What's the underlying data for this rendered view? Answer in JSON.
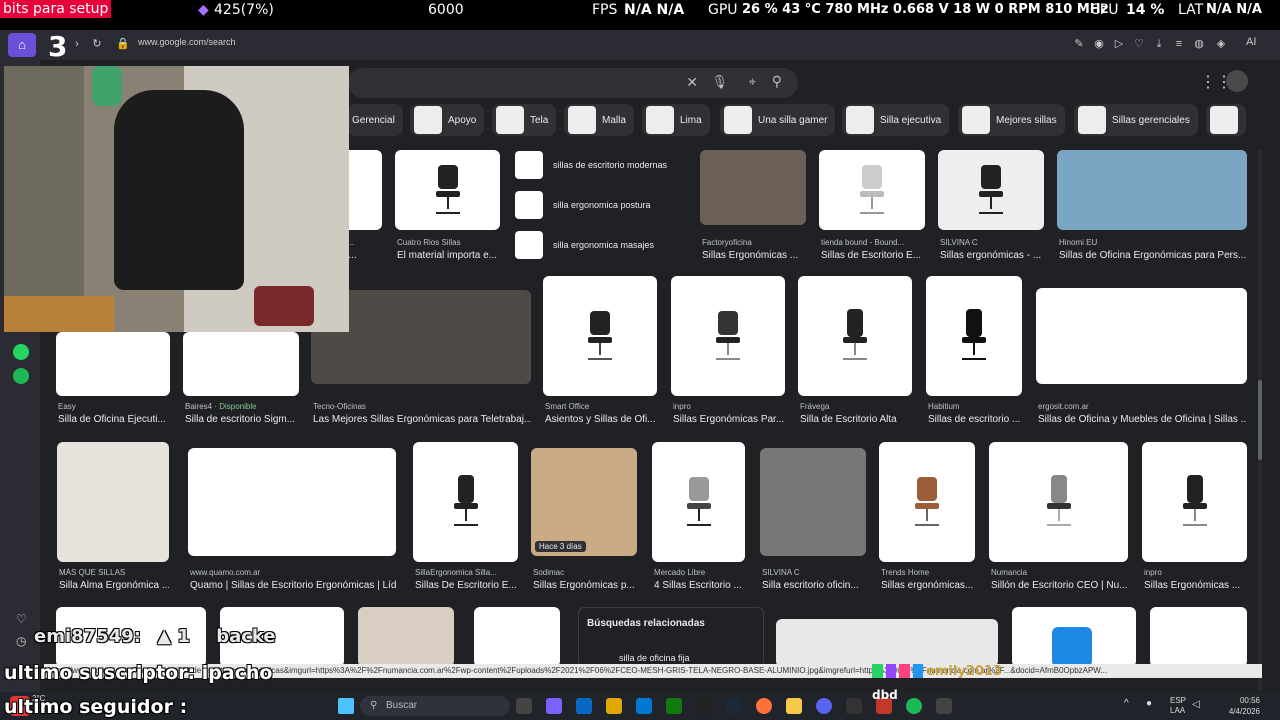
{
  "overlay": {
    "bits_label": "bits para setup",
    "bits_value": "425(7%)",
    "goal": "6000",
    "fps_label": "FPS",
    "fps_value": "N/A N/A",
    "gpu_label": "GPU",
    "gpu_stats": "26 % 43 °C 780 MHz 0.668 V 18 W 0 RPM 810 MHz",
    "cpu_label": "CPU",
    "cpu_value": "14 %",
    "lat_label": "LAT",
    "lat_value": "N/A N/A",
    "subscriber_label": "ultimo suscriptor: ipacho",
    "follower_label": "ultimo seguidor :",
    "chat_user": "emi87549:",
    "chat_msg": "backe",
    "chat_number": "1",
    "chat_user2": "emily2013",
    "alert_text": "dbd"
  },
  "browser": {
    "url": "www.google.com/search",
    "tab_counter": "3",
    "ai_label": "AI"
  },
  "chips": [
    {
      "label": "Gerencial"
    },
    {
      "label": "Apoyo"
    },
    {
      "label": "Tela"
    },
    {
      "label": "Malla"
    },
    {
      "label": "Lima"
    },
    {
      "label": "Una silla gamer"
    },
    {
      "label": "Silla ejecutiva"
    },
    {
      "label": "Mejores sillas"
    },
    {
      "label": "Sillas gerenciales"
    }
  ],
  "related_top": [
    {
      "text": "sillas de escritorio modernas"
    },
    {
      "text": "silla ergonomica postura"
    },
    {
      "text": "silla ergonomica masajes"
    }
  ],
  "row1": [
    {
      "source": "s de ...",
      "title": "ctric..."
    },
    {
      "source": "Cuatro Rios Sillas",
      "title": "El material importa e..."
    },
    {
      "source": "Factoryoficina",
      "title": "Sillas Ergonómicas ..."
    },
    {
      "source": "tienda bound - Bound...",
      "title": "Sillas de Escritorio E..."
    },
    {
      "source": "SILVINA C",
      "title": "Sillas ergonómicas - ..."
    },
    {
      "source": "Hinomi EU",
      "title": "Sillas de Oficina Ergonómicas para Pers..."
    }
  ],
  "row2": [
    {
      "source": "Easy",
      "title": "Silla de Oficina Ejecuti..."
    },
    {
      "source": "Baires4",
      "badge": "Disponible",
      "title": "Silla de escritorio Sigm..."
    },
    {
      "source": "Tecno-Oficinas",
      "title": "Las Mejores Sillas Ergonómicas para Teletrabaj..."
    },
    {
      "source": "Smart Office",
      "title": "Asientos y Sillas de Ofi..."
    },
    {
      "source": "inpro",
      "title": "Sillas Ergonómicas Par..."
    },
    {
      "source": "Frávega",
      "title": "Silla de Escritorio Alta"
    },
    {
      "source": "Habitium",
      "title": "Sillas de escritorio ..."
    },
    {
      "source": "ergosit.com.ar",
      "title": "Sillas de Oficina y Muebles de Oficina | Sillas ..."
    }
  ],
  "row3": [
    {
      "source": "MÁS QUE SILLAS",
      "title": "Silla Alma Ergonómica ..."
    },
    {
      "source": "www.quamo.com.ar",
      "title": "Quamo | Sillas de Escritorio Ergonómicas | Líd..."
    },
    {
      "source": "SillaErgonomica Silla...",
      "title": "Sillas De Escritorio E..."
    },
    {
      "source": "Sodimac",
      "badge": "Hace 3 días",
      "title": "Sillas Ergonómicas p..."
    },
    {
      "source": "Mercado Libre",
      "title": "4 Sillas Escritorio ..."
    },
    {
      "source": "SILVINA C",
      "title": "Silla escritorio oficin..."
    },
    {
      "source": "Trends Home",
      "title": "Sillas ergonómicas..."
    },
    {
      "source": "Numancia",
      "title": "Sillón de Escritorio CEO | Nu..."
    },
    {
      "source": "inpro",
      "title": "Sillas Ergonómicas ..."
    }
  ],
  "related_bottom": {
    "heading": "Búsquedas relacionadas",
    "item": "silla de oficina fija"
  },
  "status_url": "https://www.google.com/imgres?q=sillas de escritorio ergonómicas&imgurl=https%3A%2F%2Fnumancia.com.ar%2Fwp-content%2Fuploads%2F2021%2F06%2FCEO-MESH-GRIS-TELA-NEGRO-BASE-ALUMINIO.jpg&imgrefurl=https%3A%2F%2Fnumancia.com.ar%2F...&docid=AfmB0OpbzAPW...",
  "taskbar": {
    "search_placeholder": "Buscar",
    "lang": "ESP",
    "lang2": "LAA",
    "time": "00:56",
    "date": "4/4/2026",
    "weather": "2°C"
  },
  "colors": {
    "bg": "#202124",
    "card_bg": "#303134",
    "accent": "#8ab4f8",
    "green": "#81c995"
  }
}
